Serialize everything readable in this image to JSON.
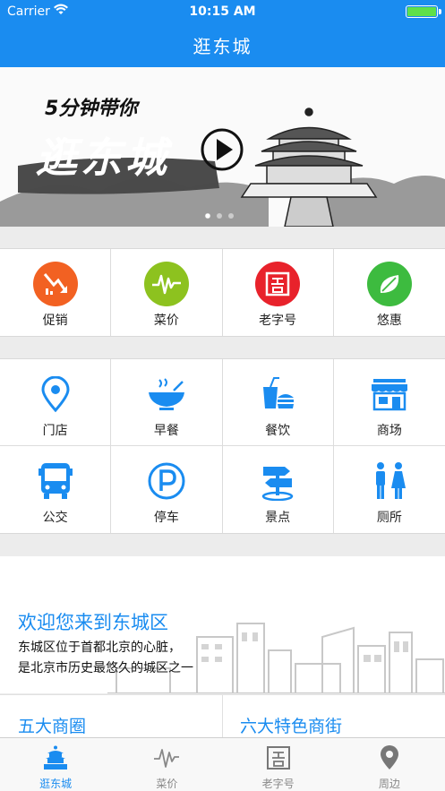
{
  "status": {
    "carrier": "Carrier",
    "time": "10:15 AM"
  },
  "nav": {
    "title": "逛东城"
  },
  "banner": {
    "tagline": "5分钟带你",
    "headline": "逛东城"
  },
  "grid1": [
    {
      "label": "促销",
      "icon": "trend-down-icon",
      "color": "#f26122"
    },
    {
      "label": "菜价",
      "icon": "pulse-icon",
      "color": "#8dc21f"
    },
    {
      "label": "老字号",
      "icon": "old-brand-icon",
      "color": "#e8222b"
    },
    {
      "label": "悠惠",
      "icon": "leaf-icon",
      "color": "#3dbb3f"
    }
  ],
  "grid2": [
    {
      "label": "门店",
      "icon": "location-pin-icon"
    },
    {
      "label": "早餐",
      "icon": "bowl-icon"
    },
    {
      "label": "餐饮",
      "icon": "fastfood-icon"
    },
    {
      "label": "商场",
      "icon": "storefront-icon"
    },
    {
      "label": "公交",
      "icon": "bus-icon"
    },
    {
      "label": "停车",
      "icon": "parking-icon"
    },
    {
      "label": "景点",
      "icon": "signpost-icon"
    },
    {
      "label": "厕所",
      "icon": "restroom-icon"
    }
  ],
  "welcome": {
    "title": "欢迎您来到东城区",
    "line1": "东城区位于首都北京的心脏，",
    "line2": "是北京市历史最悠久的城区之一"
  },
  "cards": {
    "left": "五大商圈",
    "right": "六大特色商街"
  },
  "tabs": [
    {
      "label": "逛东城",
      "icon": "temple-icon",
      "active": true
    },
    {
      "label": "菜价",
      "icon": "pulse-icon",
      "active": false
    },
    {
      "label": "老字号",
      "icon": "old-brand-icon",
      "active": false
    },
    {
      "label": "周边",
      "icon": "location-pin-icon",
      "active": false
    }
  ],
  "colors": {
    "primary": "#1a8cf0",
    "background": "#ececec"
  }
}
